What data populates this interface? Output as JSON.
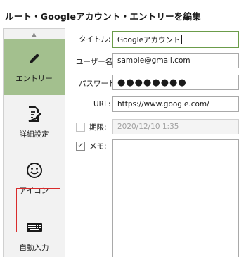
{
  "window": {
    "title": "ルート・Googleアカウント・エントリーを編集"
  },
  "sidebar": {
    "scroll_up_icon": "▲",
    "items": [
      {
        "id": "entry",
        "label": "エントリー",
        "icon": "pencil-icon",
        "active": true
      },
      {
        "id": "detail",
        "label": "詳細設定",
        "icon": "document-edit-icon",
        "active": false
      },
      {
        "id": "icon",
        "label": "アイコン",
        "icon": "smiley-icon",
        "active": false
      },
      {
        "id": "autotype",
        "label": "自動入力",
        "icon": "keyboard-icon",
        "active": false
      }
    ]
  },
  "colors": {
    "active_item": "#a3c08e",
    "highlight_border": "#d92b2b",
    "focused_border": "#6b9c4a"
  },
  "form": {
    "title_label": "タイトル:",
    "title_value": "Googleアカウント",
    "username_label": "ユーザー名:",
    "username_value": "sample@gmail.com",
    "password_label": "パスワード:",
    "password_value": "●●●●●●●●",
    "url_label": "URL:",
    "url_value": "https://www.google.com/",
    "expiry_label": "期限:",
    "expiry_value": "2020/12/10 1:35",
    "expiry_checked": false,
    "memo_label": "メモ:",
    "memo_checked": true,
    "memo_checkmark": "✓"
  }
}
